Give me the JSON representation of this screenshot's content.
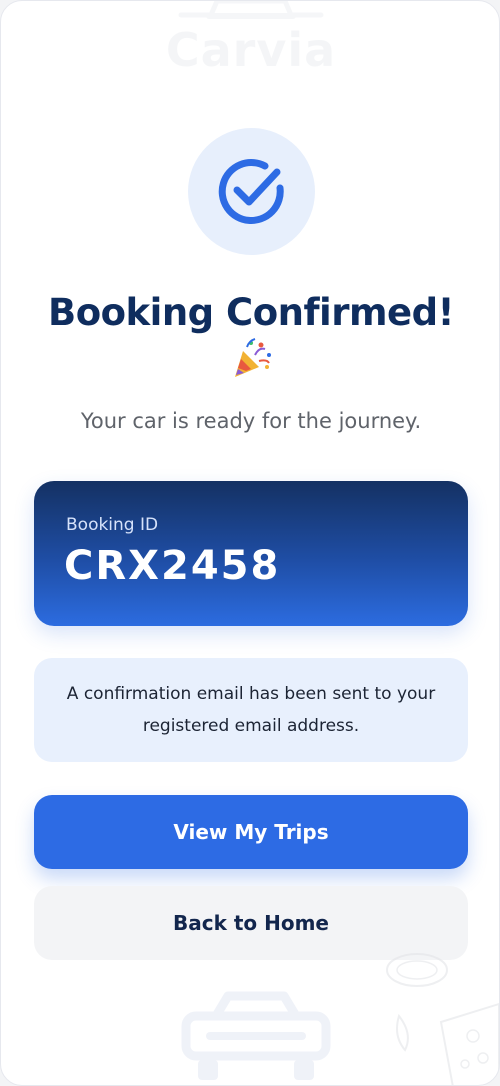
{
  "brand": {
    "watermark": "Carvia"
  },
  "confirmation": {
    "icon": "check-circle-icon",
    "title": "Booking Confirmed!",
    "emoji": "party-popper-icon",
    "subtitle": "Your car is ready for the journey."
  },
  "booking": {
    "label": "Booking ID",
    "id": "CRX2458"
  },
  "notice": {
    "text": "A confirmation email has been sent to your registered email address."
  },
  "actions": {
    "primary_label": "View My Trips",
    "secondary_label": "Back to Home"
  },
  "colors": {
    "primary": "#2d6be4",
    "title": "#0f2d5e",
    "card_top": "#143163",
    "card_bottom": "#2c6ce0",
    "notice_bg": "#e8f0fd"
  }
}
